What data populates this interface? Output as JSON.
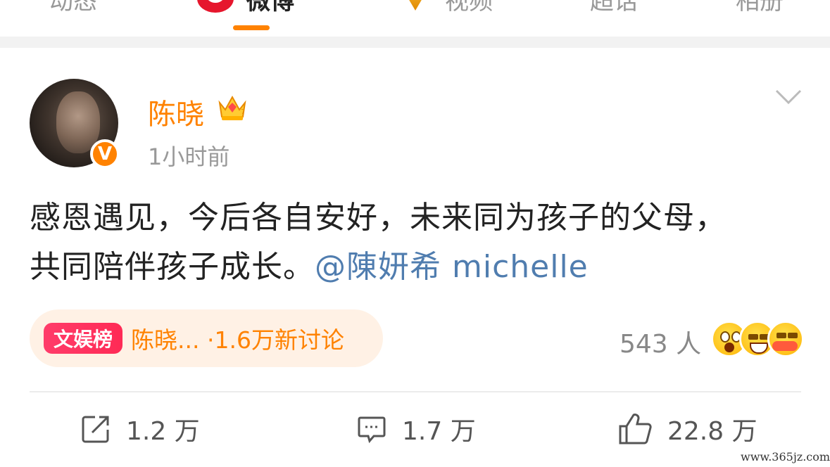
{
  "tabs": [
    {
      "label": "动态",
      "active": false
    },
    {
      "label": "微博",
      "active": true
    },
    {
      "label": "视频",
      "active": false
    },
    {
      "label": "超话",
      "active": false
    },
    {
      "label": "相册",
      "active": false
    }
  ],
  "post": {
    "username": "陈晓",
    "time": "1小时前",
    "verified_badge": "V",
    "text_line1": "感恩遇见，今后各自安好，未来同为孩子的父母，",
    "text_line2": "共同陪伴孩子成长。",
    "mention": "@陳妍希 michelle"
  },
  "topic": {
    "tag": "文娱榜",
    "text": "陈晓... ·1.6万新讨论"
  },
  "reactions": {
    "count": "543 人",
    "icons": [
      "surprised-emoji",
      "laugh-emoji",
      "hug-emoji"
    ]
  },
  "actions": {
    "repost": "1.2 万",
    "comment": "1.7 万",
    "like": "22.8 万"
  },
  "watermark": "www.365jz.com",
  "colors": {
    "accent": "#ff8200",
    "mention": "#507daf",
    "topic_tag": "#ff2a55",
    "topic_bg": "#fff1e5"
  }
}
